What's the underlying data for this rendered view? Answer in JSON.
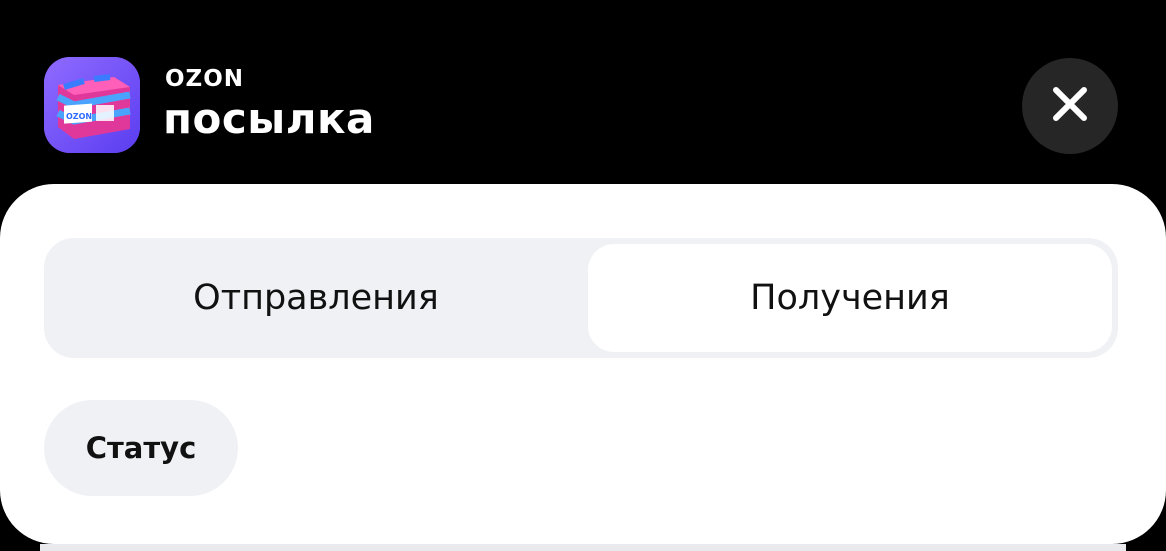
{
  "header": {
    "brand": "OZON",
    "title": "посылка",
    "app_icon": "ozon-parcel-app-icon",
    "close_icon": "close-icon"
  },
  "tabs": [
    {
      "label": "Отправления",
      "selected": false
    },
    {
      "label": "Получения",
      "selected": true
    }
  ],
  "filters": {
    "status_label": "Статус"
  },
  "colors": {
    "background": "#000000",
    "sheet": "#ffffff",
    "segment_bg": "#f0f1f5",
    "close_button_bg": "#262626"
  }
}
